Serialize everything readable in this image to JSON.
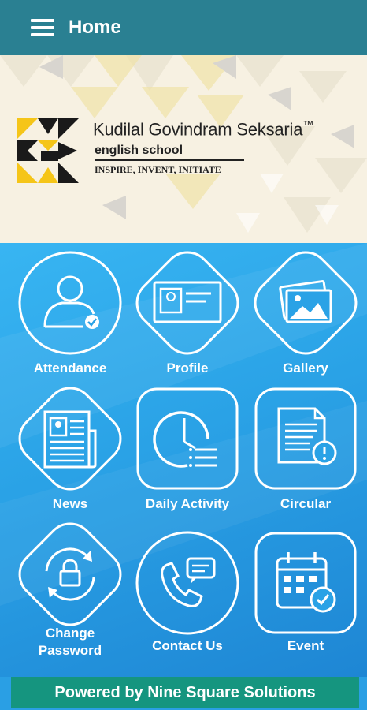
{
  "appbar": {
    "title": "Home",
    "menu_icon": "hamburger-menu-icon",
    "color": "#2a8092"
  },
  "school": {
    "name": "Kudilal Govindram Seksaria",
    "tm": "™",
    "subtitle": "english school",
    "tagline": "INSPIRE, INVENT, INITIATE"
  },
  "tiles": [
    {
      "label": "Attendance",
      "icon": "attendance-icon"
    },
    {
      "label": "Profile",
      "icon": "profile-card-icon"
    },
    {
      "label": "Gallery",
      "icon": "gallery-icon"
    },
    {
      "label": "News",
      "icon": "news-icon"
    },
    {
      "label": "Daily Activity",
      "icon": "clock-list-icon"
    },
    {
      "label": "Circular",
      "icon": "circular-icon"
    },
    {
      "label": "Change Password",
      "label_line1": "Change",
      "label_line2": "Password",
      "icon": "lock-icon"
    },
    {
      "label": "Contact Us",
      "icon": "phone-chat-icon"
    },
    {
      "label": "Event",
      "icon": "calendar-icon"
    }
  ],
  "footer": {
    "text": "Powered by Nine Square Solutions",
    "color": "#15957f"
  },
  "colors": {
    "background": "#2a9fe4",
    "banner": "#f7f1e2",
    "logo_yellow": "#f5c518"
  }
}
